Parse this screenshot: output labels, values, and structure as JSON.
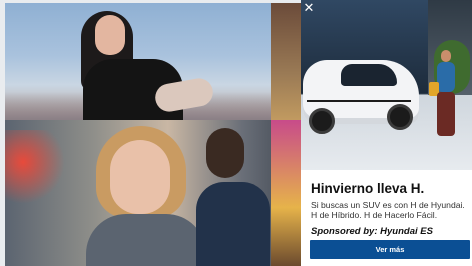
{
  "collage": {
    "top_photo": "portrait-woman-dark-hair",
    "bottom_photo": "portrait-woman-blonde-hair"
  },
  "ad": {
    "close_icon": "close-icon",
    "close_glyph": "✕",
    "image_subject": "suv-car-and-walking-woman",
    "headline": "Hinvierno lleva H.",
    "body": "Si buscas un SUV es con H de Hyundai. H de Híbrido. H de Hacerlo Fácil.",
    "sponsor": "Sponsored by: Hyundai ES",
    "cta_label": "Ver más",
    "accent_color": "#0b4f94"
  }
}
